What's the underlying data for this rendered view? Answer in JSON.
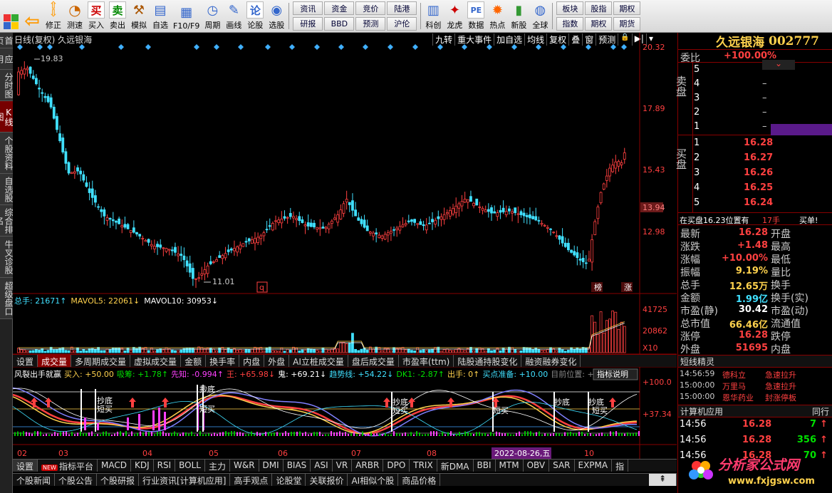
{
  "toolbar": {
    "buttons": [
      {
        "label": "",
        "icon": "windows-icon"
      },
      {
        "label": "",
        "icon": "back-arrow-icon"
      },
      {
        "label": "修正",
        "icon": "up-down-arrow-icon"
      },
      {
        "label": "测速",
        "icon": "speed-icon"
      },
      {
        "label": "买入",
        "icon": "buy-icon",
        "glyph": "买"
      },
      {
        "label": "卖出",
        "icon": "sell-icon",
        "glyph": "卖"
      },
      {
        "label": "模拟",
        "icon": "hammer-icon"
      },
      {
        "label": "自选",
        "icon": "watchlist-icon"
      },
      {
        "label": "F10/F9",
        "icon": "f10-icon"
      },
      {
        "label": "周期",
        "icon": "cycle-icon"
      },
      {
        "label": "画线",
        "icon": "pencil-icon"
      },
      {
        "label": "论股",
        "icon": "discuss-icon",
        "glyph": "论"
      },
      {
        "label": "选股",
        "icon": "stock-pick-icon"
      }
    ],
    "grid": [
      "资讯",
      "研报",
      "资金",
      "BBD",
      "竞价",
      "预测",
      "陆港",
      "沪伦"
    ],
    "buttons2": [
      {
        "label": "科创",
        "icon": "kechuang-icon"
      },
      {
        "label": "龙虎",
        "icon": "dragon-icon"
      },
      {
        "label": "数据",
        "icon": "pe-icon",
        "glyph": "PE"
      },
      {
        "label": "热点",
        "icon": "hot-icon"
      },
      {
        "label": "新股",
        "icon": "new-stock-icon"
      },
      {
        "label": "全球",
        "icon": "globe-icon"
      }
    ],
    "grid2": [
      "板块",
      "指数",
      "股指",
      "期权",
      "期权",
      "期货"
    ]
  },
  "sidebar": [
    "首页",
    "应用",
    "分时图",
    "K线图",
    "个股资料",
    "自选股",
    "综合排名",
    "牛叉诊股",
    "超级盘口"
  ],
  "chart": {
    "title": "日线(复权) 久远银海",
    "tools": [
      "九转",
      "重大事件",
      "加自选",
      "均线",
      "复权",
      "叠",
      "窗",
      "预测"
    ],
    "price_labels": [
      "20.32",
      "17.89",
      "15.43",
      "12.98"
    ],
    "current_price": "13.94",
    "high_label": "19.83",
    "low_label": "11.01",
    "markers": [
      "q",
      "榜",
      "涨"
    ],
    "volume_legend": [
      {
        "text": "总手: 21671↑",
        "color": "#40e0ff"
      },
      {
        "text": "MAVOL5: 22061↓",
        "color": "#ffd24d"
      },
      {
        "text": "MAVOL10: 30953↓",
        "color": "#ffffff"
      }
    ],
    "volume_labels": [
      "41725",
      "20862",
      "X10"
    ],
    "ind_legend": [
      {
        "text": "风裂出手就赢",
        "color": "#ffffff"
      },
      {
        "text": "买入: +50.00",
        "color": "#ffd24d"
      },
      {
        "text": "吸筹: +1.78↑",
        "color": "#00e000"
      },
      {
        "text": "先知: -0.994↑",
        "color": "#ff40ff"
      },
      {
        "text": "王: +65.98↓",
        "color": "#ff4040"
      },
      {
        "text": "鬼: +69.21↓",
        "color": "#ffffff"
      },
      {
        "text": "趋势线: +54.22↓",
        "color": "#40e0ff"
      },
      {
        "text": "DK1: -2.87↑",
        "color": "#00e000"
      },
      {
        "text": "出手: 0↑",
        "color": "#ffd24d"
      },
      {
        "text": "买点准备: +10.00",
        "color": "#40e0ff"
      },
      {
        "text": "目前位置: +27.8",
        "color": "#888888"
      }
    ],
    "ind_explain": "指标说明",
    "ind_labels": [
      "+100.0",
      "+37.34"
    ],
    "ind_texts": [
      "抄底",
      "短买",
      "抄底",
      "短买",
      "抄底",
      "短买",
      "抄底",
      "短买",
      "抄底",
      "短买"
    ],
    "x_labels": [
      "02",
      "03",
      "04",
      "05",
      "06",
      "07",
      "08",
      "09",
      "10"
    ],
    "cursor_date": "2022-08-26,五"
  },
  "ind_tabs": [
    "设置",
    "成交量",
    "多周期成交量",
    "虚拟成交量",
    "金额",
    "换手率",
    "内盘",
    "外盘",
    "AI立桩成交量",
    "盘后成交量",
    "市盈率(ttm)",
    "陆股通持股变化",
    "融资融券变化"
  ],
  "bottom_tabs": [
    "设置",
    "指标平台",
    "MACD",
    "KDJ",
    "RSI",
    "BOLL",
    "主力",
    "W&R",
    "DMI",
    "BIAS",
    "ASI",
    "VR",
    "ARBR",
    "DPO",
    "TRIX",
    "新DMA",
    "BBI",
    "MTM",
    "OBV",
    "SAR",
    "EXPMA",
    "指"
  ],
  "bottom_new": "NEW",
  "news_tabs": [
    "个股新闻",
    "个股公告",
    "个股研报",
    "行业资讯[计算机应用]",
    "高手观点",
    "论股堂",
    "关联报价",
    "AI相似个股",
    "商品价格"
  ],
  "panel": {
    "name": "久远银海",
    "code": "002777",
    "weibi_label": "委比",
    "weibi_value": "+100.00%",
    "sell_label": "卖盘",
    "buy_label": "买盘",
    "sell_rows": [
      {
        "n": "5",
        "price": "",
        "vol": ""
      },
      {
        "n": "4",
        "price": "",
        "vol": "–"
      },
      {
        "n": "3",
        "price": "",
        "vol": "–"
      },
      {
        "n": "2",
        "price": "",
        "vol": "–"
      },
      {
        "n": "1",
        "price": "",
        "vol": "–"
      }
    ],
    "buy_rows": [
      {
        "n": "1",
        "price": "16.28"
      },
      {
        "n": "2",
        "price": "16.27"
      },
      {
        "n": "3",
        "price": "16.26"
      },
      {
        "n": "4",
        "price": "16.25"
      },
      {
        "n": "5",
        "price": "16.24"
      }
    ],
    "order_note": "在买盘16.23位置有",
    "order_qty": "17手",
    "order_action": "买单!",
    "stats": [
      {
        "l1": "最新",
        "v1": "16.28",
        "c1": "red",
        "l2": "开盘"
      },
      {
        "l1": "涨跌",
        "v1": "+1.48",
        "c1": "red",
        "l2": "最高"
      },
      {
        "l1": "涨幅",
        "v1": "+10.00%",
        "c1": "red",
        "l2": "最低"
      },
      {
        "l1": "振幅",
        "v1": "9.19%",
        "c1": "yellow",
        "l2": "量比"
      },
      {
        "l1": "总手",
        "v1": "12.65万",
        "c1": "yellow",
        "l2": "换手"
      },
      {
        "l1": "金额",
        "v1": "1.99亿",
        "c1": "cyan",
        "l2": "换手(实)"
      },
      {
        "l1": "市盈(静)",
        "v1": "30.42",
        "c1": "white",
        "l2": "市盈(动)"
      },
      {
        "l1": "总市值",
        "v1": "66.46亿",
        "c1": "yellow",
        "l2": "流通值"
      },
      {
        "l1": "涨停",
        "v1": "16.28",
        "c1": "red",
        "l2": "跌停"
      },
      {
        "l1": "外盘",
        "v1": "51695",
        "c1": "red",
        "l2": "内盘"
      }
    ],
    "short_title": "短线精灵",
    "short_rows": [
      {
        "time": "14:56:59",
        "name": "德科立",
        "event": "急速拉升"
      },
      {
        "time": "15:00:00",
        "name": "万里马",
        "event": "急速拉升"
      },
      {
        "time": "15:00:00",
        "name": "恩华药业",
        "event": "封涨停板"
      }
    ],
    "industry_title": "计算机应用",
    "industry_right": "同行",
    "ticks": [
      {
        "time": "14:56",
        "price": "16.28",
        "vol": "7",
        "dir": "↑"
      },
      {
        "time": "14:56",
        "price": "16.28",
        "vol": "356",
        "dir": "↑"
      },
      {
        "time": "14:56",
        "price": "16.28",
        "vol": "70",
        "dir": "↑"
      }
    ]
  },
  "watermark": {
    "text": "分析家公式网",
    "url": "www.fxjgsw.com"
  },
  "colors": {
    "up": "#ff4040",
    "down": "#40e0ff",
    "border": "#880000",
    "accent": "#ffd24d"
  }
}
